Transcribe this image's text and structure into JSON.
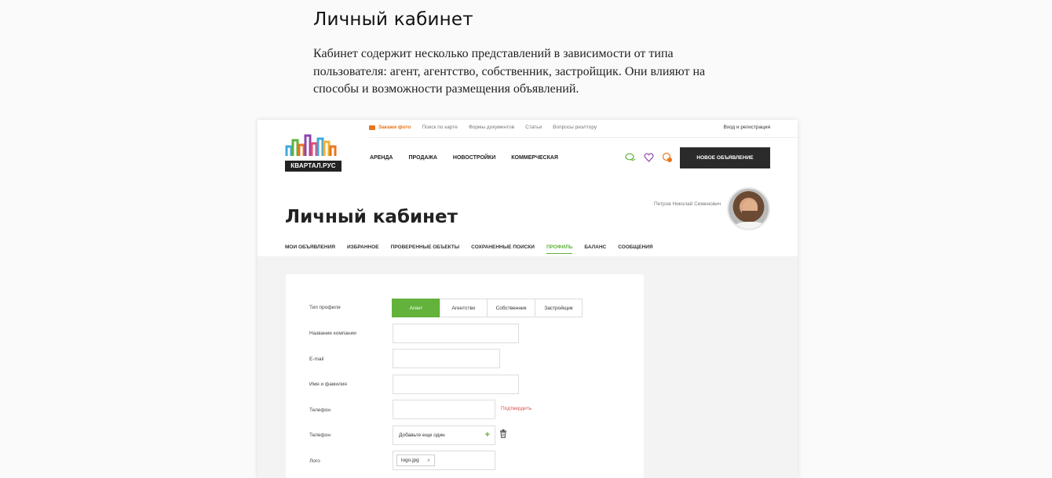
{
  "page": {
    "heading": "Личный кабинет",
    "description": "Кабинет содержит несколько представлений в зависимости от типа пользователя: агент, агентство, собственник, застройщик. Они влияют на способы и возможности размещения объявлений."
  },
  "site": {
    "logo_text": "КВАРТАЛ.РУС",
    "topbar": {
      "order_photo": "Закажи фото",
      "links": [
        "Поиск по карте",
        "Формы документов",
        "Статьи",
        "Вопросы риэлтору"
      ],
      "login": "Вход и регистрация"
    },
    "nav": [
      "АРЕНДА",
      "ПРОДАЖА",
      "НОВОСТРОЙКИ",
      "КОММЕРЧЕСКАЯ"
    ],
    "icons": [
      "chat-icon",
      "heart-icon",
      "notification-icon"
    ],
    "new_ad_button": "НОВОЕ ОБЪЯВЛЕНИЕ",
    "user_name": "Петров Николай Семенович",
    "cabinet_title": "Личный кабинет",
    "tabs": [
      "МОИ ОБЪЯВЛЕНИЯ",
      "ИЗБРАННОЕ",
      "ПРОВЕРЕННЫЕ ОБЪЕКТЫ",
      "СОХРАНЕННЫЕ ПОИСКИ",
      "ПРОФИЛЬ",
      "БАЛАНС",
      "СООБЩЕНИЯ"
    ],
    "active_tab": "ПРОФИЛЬ",
    "accent_color": "#62b23c"
  },
  "form": {
    "profile_type_label": "Тип профиля",
    "profile_types": [
      "Агент",
      "Агентство",
      "Собственник",
      "Застройщик"
    ],
    "selected_type": "Агент",
    "company_label": "Название компании",
    "company_value": "",
    "email_label": "E-mail",
    "email_value": "",
    "name_label": "Имя и фамилия",
    "name_value": "",
    "phone_label": "Телефон",
    "phone_value": "",
    "confirm_link": "Подтвердить",
    "phone2_label": "Телефон",
    "add_more": "Добавьте еще один",
    "logo_label": "Лого",
    "logo_file": "logo.jpg"
  }
}
